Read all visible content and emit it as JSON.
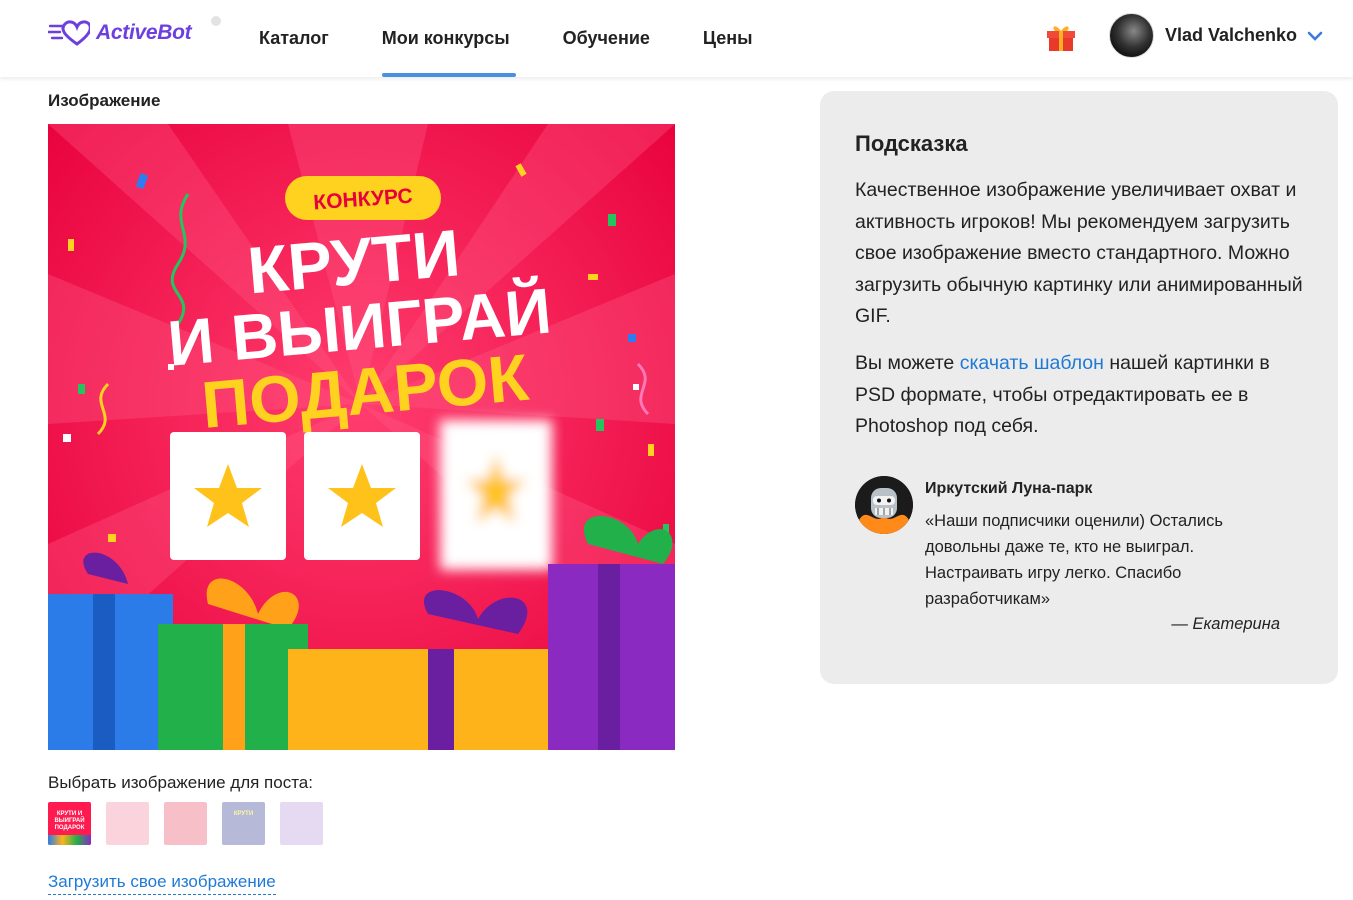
{
  "header": {
    "logo_text": "ActiveBot",
    "nav": [
      {
        "label": "Каталог",
        "active": false
      },
      {
        "label": "Мои конкурсы",
        "active": true
      },
      {
        "label": "Обучение",
        "active": false
      },
      {
        "label": "Цены",
        "active": false
      }
    ],
    "user_name": "Vlad Valchenko"
  },
  "image_section": {
    "label": "Изображение",
    "poster": {
      "badge": "КОНКУРС",
      "line1": "КРУТИ",
      "line2": "И ВЫИГРАЙ",
      "line3": "ПОДАРОК"
    },
    "choose_label": "Выбрать изображение для поста:",
    "thumbnails": [
      {
        "text": "КРУТИ И ВЫИГРАЙ ПОДАРОК"
      },
      {
        "text": ""
      },
      {
        "text": ""
      },
      {
        "text": "КРУТИ"
      },
      {
        "text": ""
      }
    ],
    "upload_link": "Загрузить свое изображение"
  },
  "hint": {
    "title": "Подсказка",
    "paragraph1": "Качественное изображение увеличивает охват и активность игроков! Мы рекомендуем загрузить свое изображение вместо стандартного. Можно загрузить обычную картинку или анимированный GIF.",
    "paragraph2_before": "Вы можете ",
    "paragraph2_link": "скачать шаблон",
    "paragraph2_after": " нашей картинки в PSD формате, чтобы отредактировать ее в Photoshop под себя.",
    "quote": {
      "author": "Иркутский Луна-парк",
      "text": "«Наши подписчики оценили) Остались довольны даже те, кто не выиграл. Настраивать игру легко. Спасибо разработчикам»",
      "signature": "— Екатерина"
    }
  },
  "colors": {
    "brand": "#6d3fe0",
    "link": "#1f7ad6",
    "nav_active": "#4a90e2",
    "poster_bg": "#ff1a4f",
    "poster_yellow": "#ffd21f"
  }
}
